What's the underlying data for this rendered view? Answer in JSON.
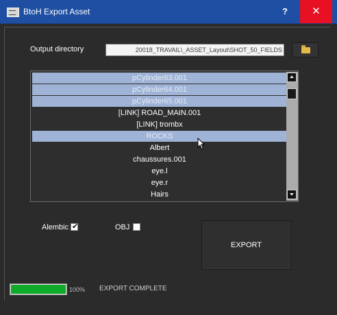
{
  "window": {
    "title": "BtoH Export Asset",
    "help_label": "?",
    "close_label": "✕"
  },
  "output": {
    "label": "Output directory",
    "path_value": "20018_TRAVAIL\\_ASSET_Layout\\SHOT_50_FIELDS",
    "browse_icon": "folder-icon"
  },
  "list": {
    "items": [
      {
        "label": "pCylinder63.001",
        "selected": true
      },
      {
        "label": "pCylinder64.001",
        "selected": true
      },
      {
        "label": "pCylinder65.001",
        "selected": true
      },
      {
        "label": "[LINK] ROAD_MAIN.001",
        "selected": false
      },
      {
        "label": "[LINK] trombx",
        "selected": false
      },
      {
        "label": "ROCKS",
        "selected": true
      },
      {
        "label": "Albert",
        "selected": false
      },
      {
        "label": "chaussures.001",
        "selected": false
      },
      {
        "label": "eye.l",
        "selected": false
      },
      {
        "label": "eye.r",
        "selected": false
      },
      {
        "label": "Hairs",
        "selected": false
      }
    ]
  },
  "options": {
    "alembic_label": "Alembic",
    "alembic_checked": true,
    "obj_label": "OBJ",
    "obj_checked": false,
    "check_glyph": "✔"
  },
  "export": {
    "button_label": "EXPORT"
  },
  "status": {
    "progress_percent": 100,
    "progress_text": "100%",
    "message": "EXPORT COMPLETE"
  },
  "colors": {
    "titlebar": "#1e4fa3",
    "close": "#e81123",
    "selection": "#9fb3d6",
    "progress": "#0faa2a"
  }
}
